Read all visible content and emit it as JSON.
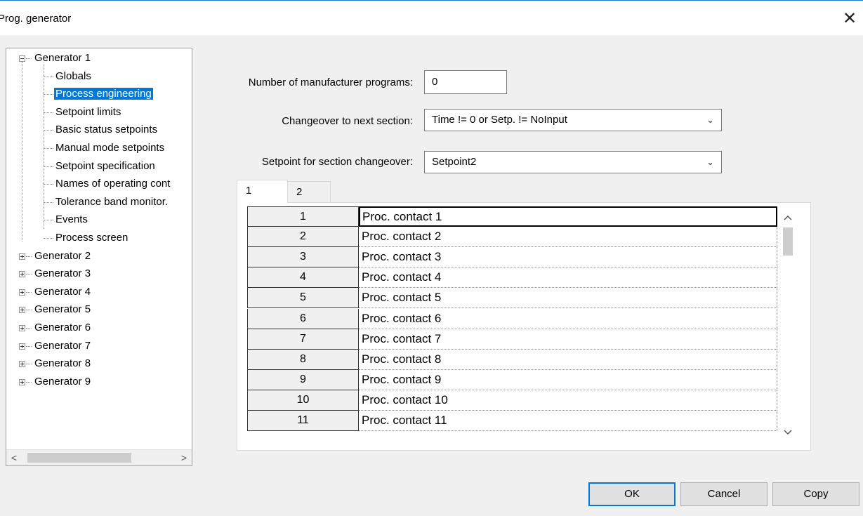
{
  "window": {
    "title": "Prog. generator",
    "close_symbol": "✕"
  },
  "tree": {
    "root": {
      "label": "Generator 1",
      "expanded": true
    },
    "children": [
      {
        "label": "Globals",
        "selected": false
      },
      {
        "label": "Process engineering",
        "selected": true
      },
      {
        "label": "Setpoint limits",
        "selected": false
      },
      {
        "label": "Basic status setpoints",
        "selected": false
      },
      {
        "label": "Manual mode setpoints",
        "selected": false
      },
      {
        "label": "Setpoint specification",
        "selected": false
      },
      {
        "label": "Names of operating cont",
        "selected": false
      },
      {
        "label": "Tolerance band monitor.",
        "selected": false
      },
      {
        "label": "Events",
        "selected": false
      },
      {
        "label": "Process screen",
        "selected": false
      }
    ],
    "collapsed": [
      {
        "label": "Generator 2"
      },
      {
        "label": "Generator 3"
      },
      {
        "label": "Generator 4"
      },
      {
        "label": "Generator 5"
      },
      {
        "label": "Generator 6"
      },
      {
        "label": "Generator 7"
      },
      {
        "label": "Generator 8"
      },
      {
        "label": "Generator 9"
      }
    ],
    "scroll_left": "<",
    "scroll_right": ">"
  },
  "form": {
    "manufacturer_programs": {
      "label": "Number of manufacturer programs:",
      "value": "0"
    },
    "changeover": {
      "label": "Changeover to next section:",
      "value": "Time != 0 or Setp. != NoInput"
    },
    "setpoint_changeover": {
      "label": "Setpoint for section changeover:",
      "value": "Setpoint2"
    }
  },
  "tabs": [
    {
      "label": "1",
      "active": true
    },
    {
      "label": "2",
      "active": false
    }
  ],
  "grid": {
    "rows": [
      {
        "num": "1",
        "text": "Proc. contact 1"
      },
      {
        "num": "2",
        "text": "Proc. contact 2"
      },
      {
        "num": "3",
        "text": "Proc. contact 3"
      },
      {
        "num": "4",
        "text": "Proc. contact 4"
      },
      {
        "num": "5",
        "text": "Proc. contact 5"
      },
      {
        "num": "6",
        "text": "Proc. contact 6"
      },
      {
        "num": "7",
        "text": "Proc. contact 7"
      },
      {
        "num": "8",
        "text": "Proc. contact 8"
      },
      {
        "num": "9",
        "text": "Proc. contact 9"
      },
      {
        "num": "10",
        "text": "Proc. contact 10"
      },
      {
        "num": "11",
        "text": "Proc. contact 11"
      }
    ],
    "scroll_up": "^",
    "scroll_down": "v"
  },
  "buttons": {
    "ok": "OK",
    "cancel": "Cancel",
    "copy": "Copy"
  }
}
